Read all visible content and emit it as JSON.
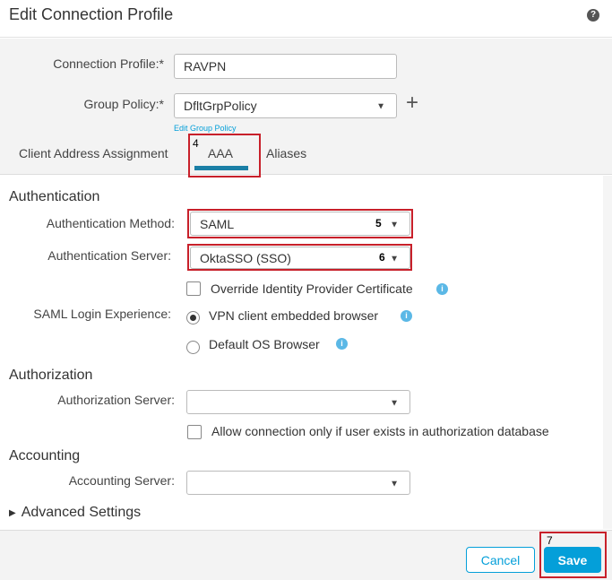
{
  "dialog": {
    "title": "Edit Connection Profile",
    "help_icon": "question-circle-icon"
  },
  "form": {
    "connection_profile_label": "Connection Profile:*",
    "connection_profile_value": "RAVPN",
    "group_policy_label": "Group Policy:*",
    "group_policy_value": "DfltGrpPolicy",
    "add_icon": "+",
    "edit_group_policy": "Edit Group Policy"
  },
  "tabs": [
    {
      "label": "Client Address Assignment"
    },
    {
      "label": "AAA",
      "active": true
    },
    {
      "label": "Aliases"
    }
  ],
  "annotations": {
    "tab": "4",
    "method": "5",
    "server": "6",
    "save": "7"
  },
  "authentication": {
    "heading": "Authentication",
    "method_label": "Authentication Method:",
    "method_value": "SAML",
    "server_label": "Authentication Server:",
    "server_value": "OktaSSO (SSO)",
    "override_label": "Override Identity Provider Certificate",
    "override_checked": false,
    "saml_label": "SAML Login Experience:",
    "saml_options": [
      {
        "label": "VPN client embedded browser",
        "selected": true
      },
      {
        "label": "Default OS Browser",
        "selected": false
      }
    ]
  },
  "authorization": {
    "heading": "Authorization",
    "server_label": "Authorization Server:",
    "server_value": "",
    "allow_label": "Allow connection only if user exists in authorization database",
    "allow_checked": false
  },
  "accounting": {
    "heading": "Accounting",
    "server_label": "Accounting Server:",
    "server_value": ""
  },
  "advanced": {
    "label": "Advanced Settings"
  },
  "footer": {
    "cancel": "Cancel",
    "save": "Save"
  },
  "colors": {
    "accent": "#049fd9",
    "tab_underline": "#1b7fa6",
    "annotation": "#c8202a"
  }
}
